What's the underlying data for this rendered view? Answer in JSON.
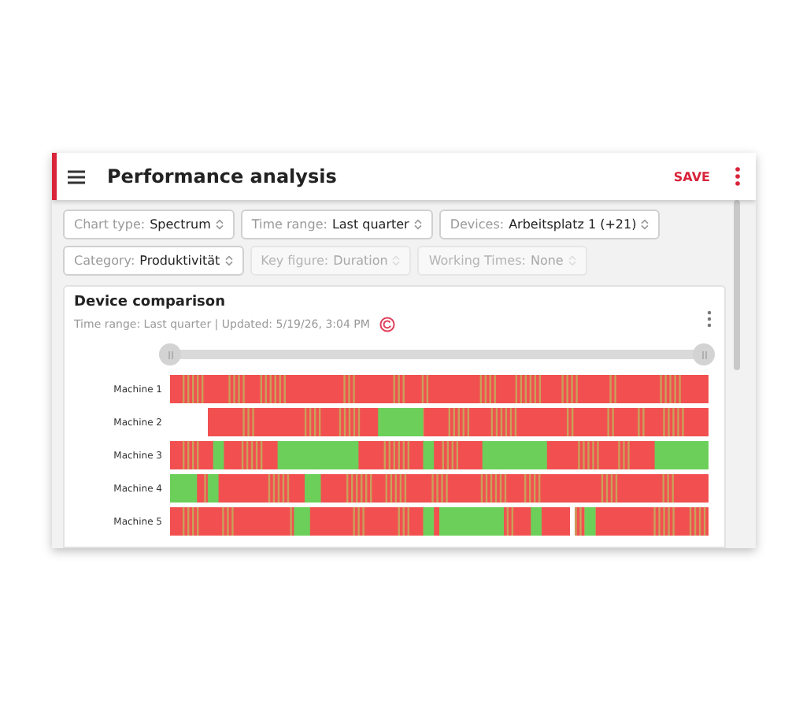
{
  "header": {
    "title": "Performance analysis",
    "save_label": "SAVE"
  },
  "filters": [
    {
      "label": "Chart type:",
      "value": "Spectrum",
      "disabled": false
    },
    {
      "label": "Time range:",
      "value": "Last quarter",
      "disabled": false
    },
    {
      "label": "Devices:",
      "value": "Arbeitsplatz 1 (+21)",
      "disabled": false
    },
    {
      "label": "Category:",
      "value": "Produktivität",
      "disabled": false
    },
    {
      "label": "Key figure:",
      "value": "Duration",
      "disabled": true
    },
    {
      "label": "Working Times:",
      "value": "None",
      "disabled": true
    }
  ],
  "card": {
    "title": "Device comparison",
    "subtitle": "Time range: Last quarter | Updated: 5/19/26, 3:04 PM",
    "slider": {
      "level": 1
    },
    "machines": [
      {
        "name": "Machine 1"
      },
      {
        "name": "Machine 2"
      },
      {
        "name": "Machine 3"
      },
      {
        "name": "Machine 4"
      },
      {
        "name": "Machine 5"
      }
    ]
  }
}
